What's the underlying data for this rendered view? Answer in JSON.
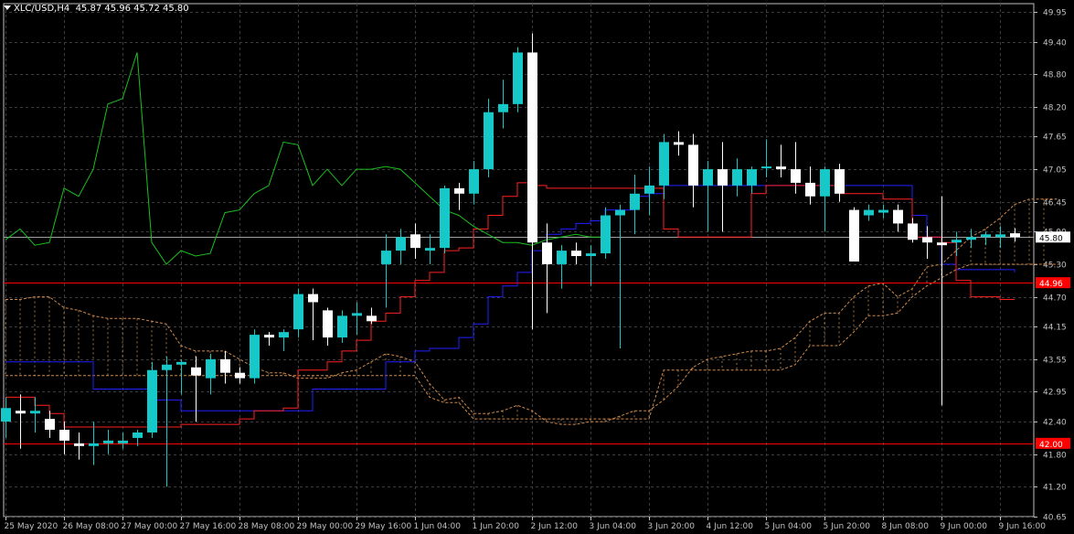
{
  "header": {
    "symbol": "XLC/USD,H4",
    "ohlc": "45.87 45.96 45.72 45.80"
  },
  "colors": {
    "background": "#000000",
    "grid": "#3c3c3c",
    "axis": "#c0c0c0",
    "bull": "#17c8c8",
    "bear": "#ffffff",
    "tenkan": "#ff2020",
    "kijun": "#1f1fff",
    "chikou": "#19c01e",
    "span_a": "#d08a4a",
    "span_b": "#d08a4a",
    "hline": "#ff0000",
    "bid_line": "#a0a0a0"
  },
  "chart_data": {
    "type": "candlestick",
    "title": "XLC/USD,H4",
    "ylim": [
      40.65,
      50.1
    ],
    "yticks": [
      "49.95",
      "49.40",
      "48.80",
      "48.20",
      "47.65",
      "47.05",
      "46.45",
      "45.90",
      "45.30",
      "44.70",
      "44.15",
      "43.55",
      "42.95",
      "42.40",
      "41.80",
      "41.20",
      "40.65"
    ],
    "xlabels": [
      {
        "i": 0,
        "label": "25 May 2020"
      },
      {
        "i": 4,
        "label": "26 May 08:00"
      },
      {
        "i": 8,
        "label": "27 May 00:00"
      },
      {
        "i": 12,
        "label": "27 May 16:00"
      },
      {
        "i": 16,
        "label": "28 May 08:00"
      },
      {
        "i": 20,
        "label": "29 May 00:00"
      },
      {
        "i": 24,
        "label": "29 May 16:00"
      },
      {
        "i": 28,
        "label": "1 Jun 04:00"
      },
      {
        "i": 32,
        "label": "1 Jun 20:00"
      },
      {
        "i": 36,
        "label": "2 Jun 12:00"
      },
      {
        "i": 40,
        "label": "3 Jun 04:00"
      },
      {
        "i": 44,
        "label": "3 Jun 20:00"
      },
      {
        "i": 48,
        "label": "4 Jun 12:00"
      },
      {
        "i": 52,
        "label": "5 Jun 04:00"
      },
      {
        "i": 56,
        "label": "5 Jun 20:00"
      },
      {
        "i": 60,
        "label": "8 Jun 08:00"
      },
      {
        "i": 64,
        "label": "9 Jun 00:00"
      },
      {
        "i": 68,
        "label": "9 Jun 16:00"
      }
    ],
    "candles": [
      [
        42.4,
        42.85,
        42.1,
        42.65
      ],
      [
        42.6,
        42.9,
        41.9,
        42.55
      ],
      [
        42.55,
        42.85,
        42.2,
        42.6
      ],
      [
        42.45,
        42.6,
        42.1,
        42.25
      ],
      [
        42.25,
        42.4,
        41.8,
        42.05
      ],
      [
        42.0,
        42.2,
        41.7,
        41.95
      ],
      [
        41.95,
        42.4,
        41.6,
        42.0
      ],
      [
        42.0,
        42.25,
        41.8,
        42.05
      ],
      [
        42.0,
        42.2,
        41.9,
        42.05
      ],
      [
        42.1,
        42.25,
        41.95,
        42.2
      ],
      [
        42.2,
        43.5,
        42.1,
        43.35
      ],
      [
        43.35,
        43.6,
        41.2,
        43.45
      ],
      [
        43.45,
        43.55,
        42.9,
        43.5
      ],
      [
        43.4,
        43.6,
        42.4,
        43.25
      ],
      [
        43.2,
        43.65,
        42.9,
        43.55
      ],
      [
        43.55,
        43.7,
        43.1,
        43.3
      ],
      [
        43.3,
        43.4,
        43.1,
        43.2
      ],
      [
        43.2,
        44.1,
        43.1,
        44.0
      ],
      [
        44.0,
        44.05,
        43.8,
        43.95
      ],
      [
        43.95,
        44.1,
        43.7,
        44.05
      ],
      [
        44.1,
        44.85,
        43.95,
        44.75
      ],
      [
        44.75,
        44.85,
        43.9,
        44.6
      ],
      [
        44.45,
        44.5,
        43.8,
        43.95
      ],
      [
        43.95,
        44.45,
        43.85,
        44.35
      ],
      [
        44.35,
        44.6,
        44.0,
        44.4
      ],
      [
        44.35,
        44.5,
        44.2,
        44.25
      ],
      [
        45.3,
        45.85,
        44.5,
        45.55
      ],
      [
        45.55,
        45.95,
        45.3,
        45.8
      ],
      [
        45.85,
        46.05,
        45.4,
        45.6
      ],
      [
        45.55,
        45.85,
        45.3,
        45.6
      ],
      [
        45.6,
        46.75,
        45.5,
        46.7
      ],
      [
        46.7,
        46.8,
        46.3,
        46.6
      ],
      [
        46.6,
        47.2,
        46.4,
        47.05
      ],
      [
        47.05,
        48.35,
        46.9,
        48.1
      ],
      [
        48.1,
        48.7,
        47.8,
        48.25
      ],
      [
        48.25,
        49.3,
        48.1,
        49.2
      ],
      [
        49.2,
        49.55,
        44.1,
        45.7
      ],
      [
        45.7,
        46.05,
        44.4,
        45.3
      ],
      [
        45.3,
        45.65,
        44.85,
        45.55
      ],
      [
        45.55,
        45.7,
        45.3,
        45.45
      ],
      [
        45.45,
        45.65,
        44.9,
        45.5
      ],
      [
        45.5,
        46.35,
        45.4,
        46.2
      ],
      [
        46.2,
        46.4,
        43.75,
        46.3
      ],
      [
        46.3,
        46.95,
        45.85,
        46.6
      ],
      [
        46.6,
        47.1,
        46.2,
        46.75
      ],
      [
        46.75,
        47.7,
        46.5,
        47.55
      ],
      [
        47.55,
        47.75,
        47.3,
        47.5
      ],
      [
        47.5,
        47.7,
        46.35,
        46.75
      ],
      [
        46.75,
        47.2,
        45.9,
        47.05
      ],
      [
        47.05,
        47.55,
        45.9,
        46.75
      ],
      [
        46.75,
        47.25,
        46.55,
        47.05
      ],
      [
        46.75,
        47.1,
        46.6,
        47.05
      ],
      [
        47.1,
        47.6,
        46.9,
        47.1
      ],
      [
        47.1,
        47.5,
        46.9,
        47.05
      ],
      [
        47.05,
        47.55,
        46.6,
        46.8
      ],
      [
        46.8,
        47.1,
        46.4,
        46.55
      ],
      [
        46.55,
        47.1,
        45.9,
        47.05
      ],
      [
        47.05,
        47.15,
        46.45,
        46.6
      ],
      [
        46.3,
        46.35,
        45.4,
        45.35
      ],
      [
        46.2,
        46.4,
        46.1,
        46.3
      ],
      [
        46.25,
        46.4,
        46.15,
        46.3
      ],
      [
        46.3,
        46.4,
        45.9,
        46.05
      ],
      [
        46.05,
        46.15,
        45.7,
        45.75
      ],
      [
        45.8,
        46.0,
        45.4,
        45.7
      ],
      [
        45.7,
        46.55,
        42.7,
        45.65
      ],
      [
        45.7,
        45.9,
        45.45,
        45.75
      ],
      [
        45.75,
        45.95,
        45.6,
        45.8
      ],
      [
        45.8,
        45.9,
        45.65,
        45.85
      ],
      [
        45.8,
        46.0,
        45.6,
        45.85
      ],
      [
        45.87,
        45.96,
        45.72,
        45.8
      ]
    ],
    "tenkan": [
      42.85,
      42.85,
      42.7,
      42.55,
      42.3,
      42.3,
      42.3,
      42.3,
      42.3,
      42.3,
      42.3,
      42.3,
      42.35,
      42.35,
      42.35,
      42.35,
      42.45,
      42.6,
      42.6,
      42.65,
      43.35,
      43.35,
      43.5,
      43.7,
      43.9,
      44.25,
      44.4,
      44.7,
      45.0,
      45.15,
      45.55,
      45.6,
      45.95,
      46.2,
      46.55,
      46.8,
      46.75,
      46.7,
      46.7,
      46.7,
      46.7,
      46.7,
      46.7,
      46.7,
      46.7,
      45.95,
      45.8,
      45.8,
      45.8,
      45.8,
      45.8,
      46.6,
      46.75,
      46.75,
      46.75,
      46.75,
      46.75,
      46.6,
      46.6,
      46.6,
      46.5,
      46.5,
      45.8,
      45.8,
      45.7,
      45.0,
      44.7,
      44.7,
      44.65,
      44.65
    ],
    "kijun": [
      43.5,
      43.5,
      43.5,
      43.5,
      43.5,
      43.5,
      43.0,
      43.0,
      43.0,
      43.0,
      42.8,
      42.8,
      42.6,
      42.6,
      42.6,
      42.6,
      42.6,
      42.6,
      42.6,
      42.6,
      42.6,
      43.0,
      43.0,
      43.0,
      43.0,
      43.0,
      43.5,
      43.5,
      43.7,
      43.75,
      43.75,
      43.95,
      44.2,
      44.7,
      44.9,
      45.15,
      45.55,
      45.85,
      45.95,
      46.05,
      46.1,
      46.3,
      46.3,
      46.55,
      46.6,
      46.75,
      46.75,
      46.75,
      46.75,
      46.75,
      46.75,
      46.75,
      46.75,
      46.75,
      46.75,
      46.75,
      46.75,
      46.75,
      46.75,
      46.75,
      46.75,
      46.75,
      46.2,
      45.8,
      45.3,
      45.2,
      45.2,
      45.2,
      45.2,
      45.15
    ],
    "chikou": [
      45.75,
      45.95,
      45.65,
      45.7,
      46.7,
      46.55,
      47.05,
      48.25,
      48.35,
      49.2,
      45.7,
      45.3,
      45.55,
      45.45,
      45.5,
      46.25,
      46.3,
      46.6,
      46.75,
      47.55,
      47.5,
      46.75,
      47.05,
      46.75,
      47.05,
      47.05,
      47.1,
      47.05,
      46.8,
      46.55,
      46.3,
      46.2,
      46.0,
      45.85,
      45.7,
      45.7,
      45.65,
      45.75,
      45.8,
      45.85,
      45.8,
      45.8
    ],
    "span_a": [
      44.65,
      44.65,
      44.7,
      44.7,
      44.5,
      44.45,
      44.35,
      44.3,
      44.3,
      44.3,
      44.25,
      44.2,
      43.8,
      43.7,
      43.7,
      43.7,
      43.55,
      43.4,
      43.3,
      43.3,
      43.2,
      43.2,
      43.2,
      43.3,
      43.35,
      43.5,
      43.65,
      43.6,
      43.5,
      43.1,
      42.8,
      42.85,
      42.55,
      42.55,
      42.6,
      42.7,
      42.6,
      42.4,
      42.35,
      42.35,
      42.4,
      42.4,
      42.5,
      42.6,
      42.6,
      42.8,
      43.05,
      43.4,
      43.55,
      43.6,
      43.65,
      43.7,
      43.7,
      43.75,
      43.95,
      44.25,
      44.4,
      44.4,
      44.7,
      44.9,
      44.95,
      44.7,
      44.85,
      45.25,
      45.3,
      45.55,
      45.8,
      45.95,
      46.15,
      46.4,
      46.5,
      46.5,
      46.5
    ],
    "span_b": [
      43.25,
      43.25,
      43.25,
      43.25,
      43.25,
      43.25,
      43.25,
      43.25,
      43.25,
      43.25,
      43.25,
      43.25,
      43.25,
      43.25,
      43.25,
      43.25,
      43.25,
      43.25,
      43.25,
      43.25,
      43.25,
      43.25,
      43.25,
      43.25,
      43.25,
      43.25,
      43.25,
      43.25,
      43.25,
      42.85,
      42.75,
      42.75,
      42.45,
      42.45,
      42.45,
      42.45,
      42.45,
      42.45,
      42.45,
      42.45,
      42.45,
      42.45,
      42.45,
      42.45,
      42.45,
      43.35,
      43.35,
      43.35,
      43.35,
      43.35,
      43.35,
      43.35,
      43.35,
      43.35,
      43.45,
      43.8,
      43.8,
      43.8,
      44.05,
      44.35,
      44.35,
      44.4,
      44.7,
      44.9,
      45.05,
      45.2,
      45.3,
      45.3,
      45.3,
      45.3,
      45.3,
      45.3,
      45.3
    ],
    "hlines": [
      {
        "value": 44.96,
        "label": "44.96"
      },
      {
        "value": 42.0,
        "label": "42.00"
      }
    ],
    "bid": {
      "value": 45.8,
      "label": "45.80"
    }
  }
}
